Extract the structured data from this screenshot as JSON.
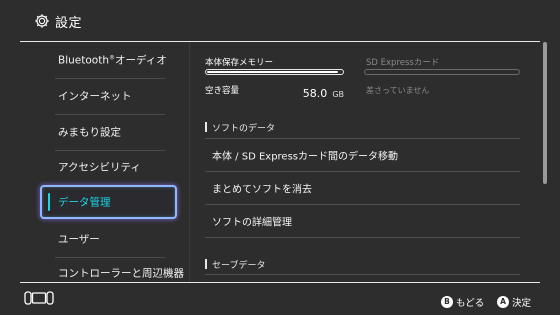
{
  "header": {
    "title": "設定",
    "icon": "gear-icon"
  },
  "sidebar": {
    "items": [
      {
        "label": "Bluetooth",
        "sup": "®",
        "suffix": "オーディオ"
      },
      {
        "label": "インターネット"
      },
      {
        "label": "みまもり設定"
      },
      {
        "label": "アクセシビリティ"
      },
      {
        "label": "データ管理",
        "selected": true
      },
      {
        "label": "ユーザー"
      },
      {
        "label": "コントローラーと周辺機器"
      }
    ]
  },
  "storage": {
    "internal": {
      "title": "本体保存メモリー",
      "used_fraction": 0.97,
      "free_label": "空き容量",
      "free_value": "58.0",
      "free_unit": "GB"
    },
    "sd": {
      "title": "SD Expressカード",
      "status": "差さっていません"
    }
  },
  "sections": {
    "software": {
      "title": "ソフトのデータ",
      "rows": [
        {
          "label": "本体 / SD Expressカード間のデータ移動"
        },
        {
          "label": "まとめてソフトを消去"
        },
        {
          "label": "ソフトの詳細管理"
        }
      ]
    },
    "save": {
      "title": "セーブデータ"
    }
  },
  "footer": {
    "back": {
      "button": "B",
      "label": "もどる"
    },
    "ok": {
      "button": "A",
      "label": "決定"
    }
  },
  "colors": {
    "background": "#2d2d2d",
    "accent": "#19d7e6",
    "selection_border": "#8fb6ff"
  }
}
